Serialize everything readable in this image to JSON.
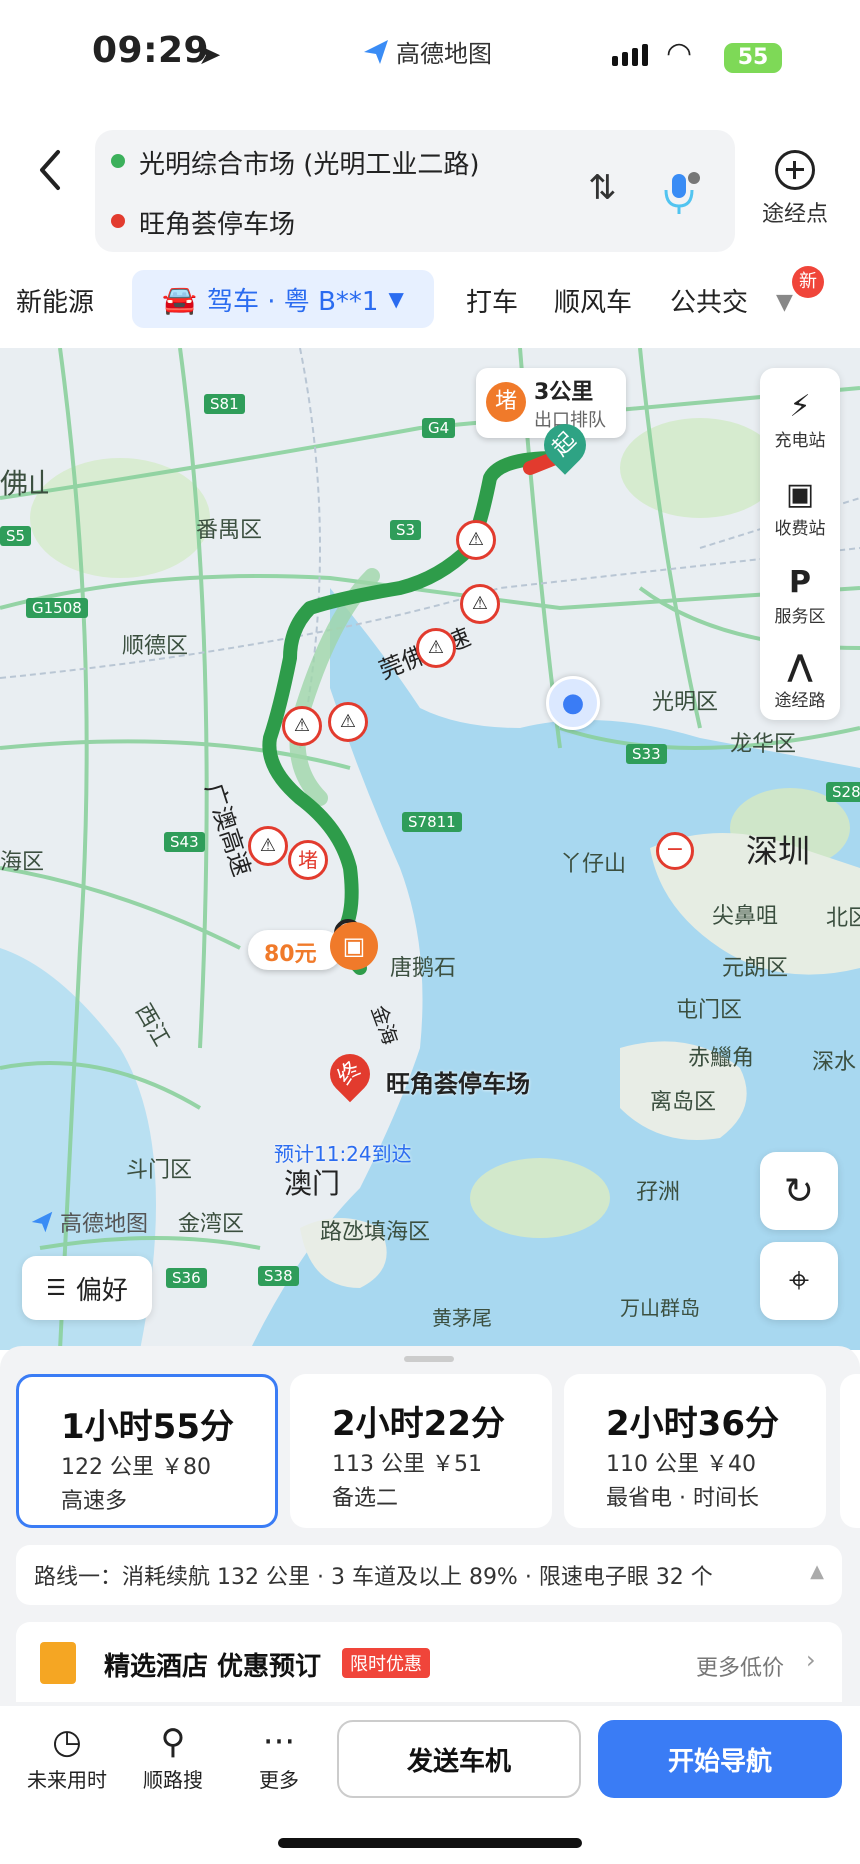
{
  "status_bar": {
    "time": "09:29",
    "brand": "高德地图",
    "battery": "55"
  },
  "route_header": {
    "origin": "光明综合市场 (光明工业二路)",
    "destination": "旺角荟停车场",
    "add_waypoint_label": "途经点",
    "icons": [
      "back-icon",
      "swap-icon",
      "voice-mic-icon",
      "add-icon"
    ]
  },
  "transport_tabs": [
    {
      "label": "新能源"
    },
    {
      "label": "驾车 · 粤 B**1",
      "selected": true
    },
    {
      "label": "打车"
    },
    {
      "label": "顺风车"
    },
    {
      "label": "公共交"
    }
  ],
  "new_badge": "新",
  "map": {
    "place_labels": [
      "番禺区",
      "顺德区",
      "海区",
      "光明区",
      "龙华区",
      "深圳",
      "丫仔山",
      "尖鼻咀",
      "元朗区",
      "屯门区",
      "赤鱲角",
      "离岛区",
      "深水",
      "北区",
      "唐鹅石",
      "斗门区",
      "金湾区",
      "澳门",
      "路氹填海区",
      "孖洲",
      "黄茅尾",
      "万山群岛",
      "西江",
      "佛山"
    ],
    "road_labels": [
      "莞佛高速",
      "广澳高速",
      "金海"
    ],
    "road_shields": [
      "S81",
      "G4",
      "S3",
      "S5",
      "G1508",
      "S33",
      "S43",
      "S7811",
      "S36",
      "S38",
      "S28"
    ],
    "traffic_callout": {
      "badge": "堵",
      "distance": "3公里",
      "note": "出口排队"
    },
    "start_marker": "起",
    "end_marker": "终",
    "end_label": "旺角荟停车场",
    "congestion_marker": "堵",
    "toll_callout": "80元",
    "eta": "预计11:24到达",
    "watermark": "高德地图",
    "side_panel": [
      {
        "label": "充电站",
        "icon": "charging-station-icon"
      },
      {
        "label": "收费站",
        "icon": "toll-station-icon"
      },
      {
        "label": "服务区",
        "icon": "service-area-icon"
      },
      {
        "label": "途经路",
        "icon": "road-icon"
      }
    ],
    "preference_label": "偏好"
  },
  "routes": [
    {
      "duration": "1小时55分",
      "distance_cost": "122 公里 ￥80",
      "tag": "高速多",
      "selected": true
    },
    {
      "duration": "2小时22分",
      "distance_cost": "113 公里 ￥51",
      "tag": "备选二"
    },
    {
      "duration": "2小时36分",
      "distance_cost": "110 公里 ￥40",
      "tag": "最省电 · 时间长"
    }
  ],
  "route_info": "路线一：消耗续航 132 公里 · 3 车道及以上 89% · 限速电子眼 32 个",
  "hotel_banner": {
    "title": "精选酒店 优惠预订",
    "badge": "限时优惠",
    "more": "更多低价"
  },
  "bottom_bar": {
    "future_label": "未来用时",
    "search_label": "顺路搜",
    "more_label": "更多",
    "send_label": "发送车机",
    "navigate_label": "开始导航"
  },
  "colors": {
    "accent_blue": "#3a7cf5",
    "route_green": "#2e9c4a",
    "congestion_red": "#e23b2e",
    "badge_orange": "#f07a2a"
  }
}
